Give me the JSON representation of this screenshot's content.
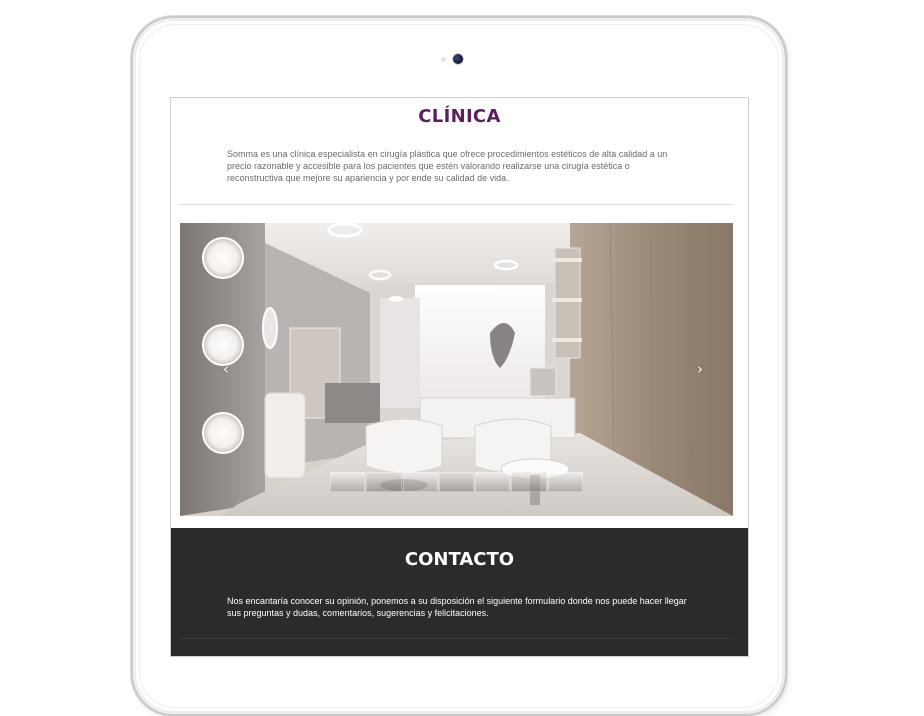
{
  "clinic": {
    "title": "CLÍNICA",
    "description": "Somma es una clínica especialista en cirugía plástica que ofrece procedimientos estéticos de alta calidad a un precio razonable y accesible para los pacientes que estén valorando realizarse una cirugía estética o reconstructiva que mejore su apariencia y por ende su calidad de vida."
  },
  "slider": {
    "prev_icon": "chevron-left-icon",
    "next_icon": "chevron-right-icon",
    "prev_glyph": "‹",
    "next_glyph": "›",
    "thumbnail_count": 7
  },
  "contact": {
    "title": "CONTACTO",
    "description": "Nos encantaría conocer su opinión, ponemos a su disposición el siguiente formulario donde nos puede hacer llegar sus preguntas y dudas, comentarios, sugerencias y felicitaciones."
  },
  "colors": {
    "title_purple": "#5c1f5e",
    "contact_bg": "#2b2b2b"
  }
}
